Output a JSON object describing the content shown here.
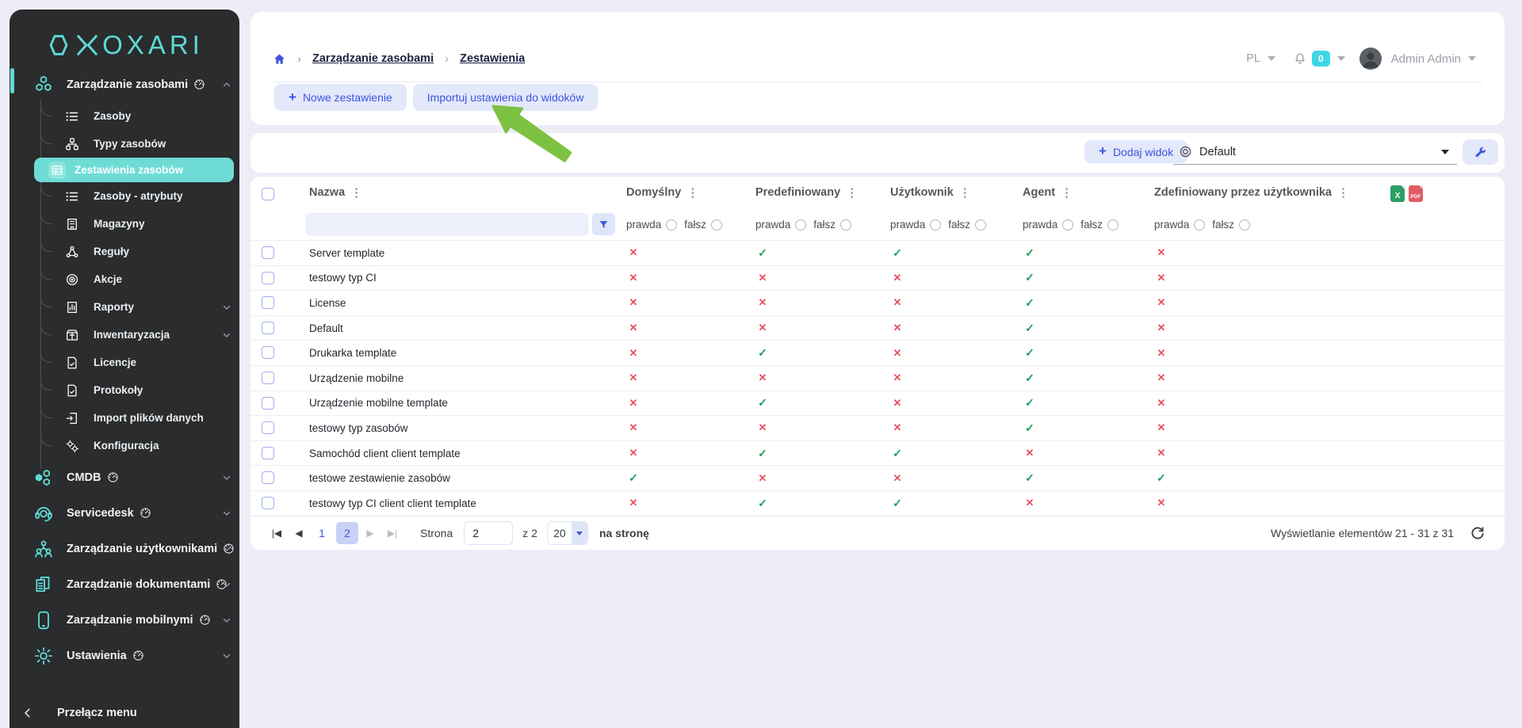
{
  "sidebar": {
    "logo_text": "OXARI",
    "items": [
      {
        "id": "zarzadzanie-zasobami",
        "label": "Zarządzanie zasobami",
        "icon": "hexagons-icon",
        "type": "section",
        "gauge": true,
        "chevron": "up",
        "active": true
      },
      {
        "id": "zasoby",
        "label": "Zasoby",
        "icon": "list-icon",
        "type": "sub"
      },
      {
        "id": "typy-zasobow",
        "label": "Typy zasobów",
        "icon": "types-icon",
        "type": "sub"
      },
      {
        "id": "zestawienia-zasobow",
        "label": "Zestawienia zasobów",
        "icon": "table-icon",
        "type": "sub",
        "selected": true
      },
      {
        "id": "zasoby-atrybuty",
        "label": "Zasoby - atrybuty",
        "icon": "list-icon",
        "type": "sub"
      },
      {
        "id": "magazyny",
        "label": "Magazyny",
        "icon": "warehouse-icon",
        "type": "sub"
      },
      {
        "id": "reguly",
        "label": "Reguły",
        "icon": "rules-icon",
        "type": "sub"
      },
      {
        "id": "akcje",
        "label": "Akcje",
        "icon": "target-icon",
        "type": "sub"
      },
      {
        "id": "raporty",
        "label": "Raporty",
        "icon": "report-icon",
        "type": "sub",
        "chevron": "down"
      },
      {
        "id": "inwentaryzacja",
        "label": "Inwentaryzacja",
        "icon": "inventory-icon",
        "type": "sub",
        "chevron": "down"
      },
      {
        "id": "licencje",
        "label": "Licencje",
        "icon": "license-icon",
        "type": "sub"
      },
      {
        "id": "protokoly",
        "label": "Protokoły",
        "icon": "license-icon",
        "type": "sub"
      },
      {
        "id": "import-plikow-danych",
        "label": "Import plików danych",
        "icon": "import-icon",
        "type": "sub"
      },
      {
        "id": "konfiguracja",
        "label": "Konfiguracja",
        "icon": "config-icon",
        "type": "sub"
      },
      {
        "id": "cmdb",
        "label": "CMDB",
        "icon": "cmdb-icon",
        "type": "section",
        "gauge": true,
        "chevron": "down"
      },
      {
        "id": "servicedesk",
        "label": "Servicedesk",
        "icon": "headset-icon",
        "type": "section",
        "gauge": true,
        "chevron": "down"
      },
      {
        "id": "zarzadzanie-uzytkownikami",
        "label": "Zarządzanie użytkownikami",
        "icon": "users-icon",
        "type": "section",
        "gauge": true,
        "chevron": "down"
      },
      {
        "id": "zarzadzanie-dokumentami",
        "label": "Zarządzanie dokumentami",
        "icon": "documents-icon",
        "type": "section",
        "gauge": true,
        "chevron": "down"
      },
      {
        "id": "zarzadzanie-mobilnymi",
        "label": "Zarządzanie mobilnymi",
        "icon": "mobile-icon",
        "type": "section",
        "gauge": true,
        "chevron": "down"
      },
      {
        "id": "ustawienia",
        "label": "Ustawienia",
        "icon": "gear-icon",
        "type": "section",
        "gauge": true,
        "chevron": "down"
      }
    ],
    "toggle_label": "Przełącz menu"
  },
  "breadcrumb": {
    "items": [
      "Zarządzanie zasobami",
      "Zestawienia"
    ]
  },
  "header": {
    "language": "PL",
    "notifications_count": "0",
    "user_name": "Admin Admin"
  },
  "actions": {
    "new_label": "Nowe zestawienie",
    "plus_glyph": "+",
    "import_label": "Importuj ustawienia do widoków"
  },
  "toolbar": {
    "add_view_label": "Dodaj widok",
    "view_selector_value": "Default"
  },
  "table": {
    "name_column": "Nazwa",
    "columns": [
      "Domyślny",
      "Predefiniowany",
      "Użytkownik",
      "Agent",
      "Zdefiniowany przez użytkownika"
    ],
    "radio_true_label": "prawda",
    "radio_false_label": "fałsz",
    "filter_value": "",
    "export": {
      "xls_label": "X",
      "pdf_label": "PDF"
    },
    "check_glyph": "✓",
    "cross_glyph": "✕",
    "rows": [
      {
        "name": "Server template",
        "values": [
          false,
          true,
          true,
          true,
          false
        ]
      },
      {
        "name": "testowy typ CI",
        "values": [
          false,
          false,
          false,
          true,
          false
        ]
      },
      {
        "name": "License",
        "values": [
          false,
          false,
          false,
          true,
          false
        ]
      },
      {
        "name": "Default",
        "values": [
          false,
          false,
          false,
          true,
          false
        ]
      },
      {
        "name": "Drukarka template",
        "values": [
          false,
          true,
          false,
          true,
          false
        ]
      },
      {
        "name": "Urządzenie mobilne",
        "values": [
          false,
          false,
          false,
          true,
          false
        ]
      },
      {
        "name": "Urządzenie mobilne template",
        "values": [
          false,
          true,
          false,
          true,
          false
        ]
      },
      {
        "name": "testowy typ zasobów",
        "values": [
          false,
          false,
          false,
          true,
          false
        ]
      },
      {
        "name": "Samochód client client template",
        "values": [
          false,
          true,
          true,
          false,
          false
        ]
      },
      {
        "name": "testowe zestawienie zasobów",
        "values": [
          true,
          false,
          false,
          true,
          true
        ]
      },
      {
        "name": "testowy typ CI client client template",
        "values": [
          false,
          true,
          true,
          false,
          false
        ]
      }
    ]
  },
  "pagination": {
    "pages": [
      "1",
      "2"
    ],
    "active_page": "2",
    "page_label": "Strona",
    "page_input_value": "2",
    "of_label": "z 2",
    "page_size": "20",
    "per_page_label": "na stronę",
    "summary": "Wyświetlanie elementów 21 - 31 z 31"
  },
  "colors": {
    "accent_teal": "#5fd9d3",
    "accent_blue": "#3b55dd",
    "check_green": "#18a058",
    "cross_red": "#e8505f",
    "arrow_green": "#7dc142",
    "badge_cyan": "#3fd6e8"
  }
}
